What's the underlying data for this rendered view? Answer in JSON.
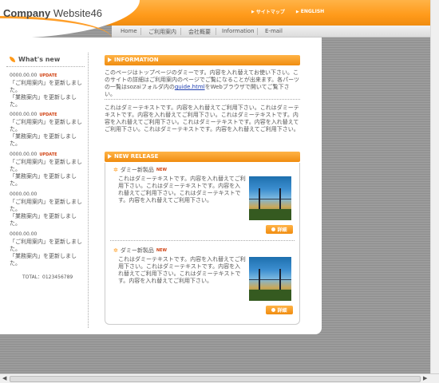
{
  "header": {
    "logo_bold": "Company",
    "logo_rest": " Website46",
    "links": [
      {
        "label": "サイトマップ"
      },
      {
        "label": "ENGLISH"
      }
    ]
  },
  "nav": {
    "items": [
      "Home",
      "ご利用案内",
      "会社概要",
      "Information",
      "E-mail"
    ]
  },
  "sidebar": {
    "title": "What's new",
    "news": [
      {
        "date": "0000.00.00",
        "badge": "UPDATE",
        "line1": "「ご利用案内」を更新しました。",
        "line2": "「業務案内」を更新しました。"
      },
      {
        "date": "0000.00.00",
        "badge": "UPDATE",
        "line1": "「ご利用案内」を更新しました。",
        "line2": "「業務案内」を更新しました。"
      },
      {
        "date": "0000.00.00",
        "badge": "UPDATE",
        "line1": "「ご利用案内」を更新しました。",
        "line2": "「業務案内」を更新しました。"
      },
      {
        "date": "0000.00.00",
        "badge": "",
        "line1": "「ご利用案内」を更新しました。",
        "line2": "「業務案内」を更新しました。"
      },
      {
        "date": "0000.00.00",
        "badge": "",
        "line1": "「ご利用案内」を更新しました。",
        "line2": "「業務案内」を更新しました。"
      }
    ],
    "total": "TOTAL：0123456789"
  },
  "information": {
    "heading": "INFORMATION",
    "para1_a": "このページはトップページのダミーです。内容を入れ替えてお使い下さい。このサイトの詳細はご利用案内のページでご覧になることが出来ます。各パーツの一覧はsozaiフォルダ内の",
    "para1_link": "guide.html",
    "para1_b": "をWebブラウザで開いてご覧下さい。",
    "para2": "これはダミーテキストです。内容を入れ替えてご利用下さい。これはダミーテキストです。内容を入れ替えてご利用下さい。これはダミーテキストです。内容を入れ替えてご利用下さい。これはダミーテキストです。内容を入れ替えてご利用下さい。これはダミーテキストです。内容を入れ替えてご利用下さい。"
  },
  "new_release": {
    "heading": "NEW RELEASE",
    "products": [
      {
        "title": "ダミー新製品",
        "badge": "NEW",
        "text": "これはダミーテキストです。内容を入れ替えてご利用下さい。これはダミーテキストです。内容を入れ替えてご利用下さい。これはダミーテキストです。内容を入れ替えてご利用下さい。",
        "button": "詳細"
      },
      {
        "title": "ダミー新製品",
        "badge": "NEW",
        "text": "これはダミーテキストです。内容を入れ替えてご利用下さい。これはダミーテキストです。内容を入れ替えてご利用下さい。これはダミーテキストです。内容を入れ替えてご利用下さい。",
        "button": "詳細"
      }
    ]
  },
  "colors": {
    "accent": "#ff9a1a",
    "badge": "#d04010",
    "link": "#2040b0"
  },
  "icons": {
    "header_link": "triangle-arrow-icon",
    "section": "play-arrow-icon",
    "sidebar_title": "leaf-icon",
    "product": "star-icon",
    "detail": "dot-icon"
  }
}
